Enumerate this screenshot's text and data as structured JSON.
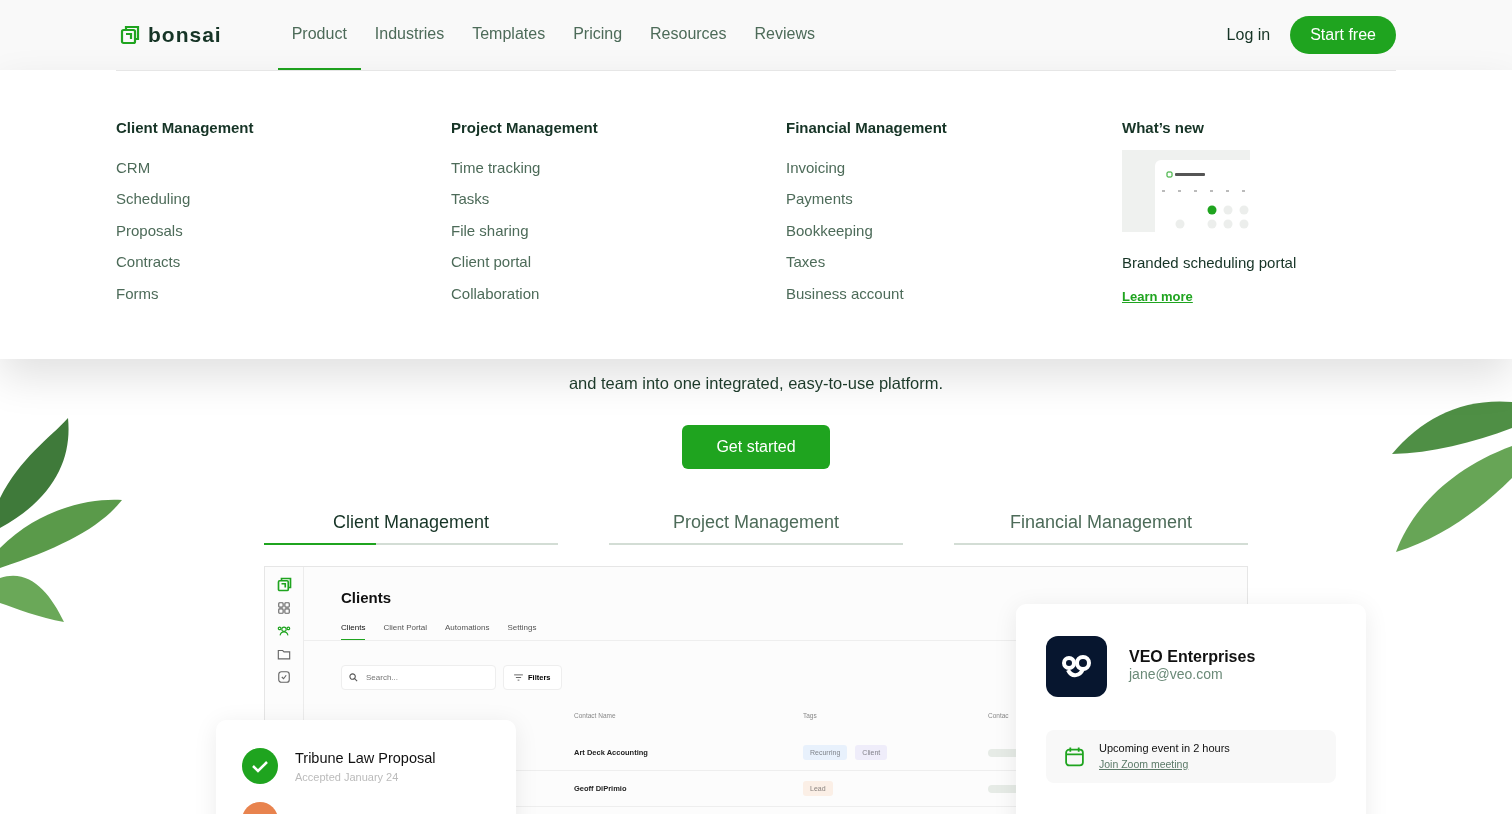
{
  "header": {
    "logo": "bonsai",
    "nav": [
      {
        "label": "Product",
        "selected": true
      },
      {
        "label": "Industries",
        "selected": false
      },
      {
        "label": "Templates",
        "selected": false
      },
      {
        "label": "Pricing",
        "selected": false
      },
      {
        "label": "Resources",
        "selected": false
      },
      {
        "label": "Reviews",
        "selected": false
      }
    ],
    "login": "Log in",
    "cta": "Start free"
  },
  "menu": {
    "columns": [
      {
        "title": "Client Management",
        "items": [
          "CRM",
          "Scheduling",
          "Proposals",
          "Contracts",
          "Forms"
        ]
      },
      {
        "title": "Project Management",
        "items": [
          "Time tracking",
          "Tasks",
          "File sharing",
          "Client portal",
          "Collaboration"
        ]
      },
      {
        "title": "Financial Management",
        "items": [
          "Invoicing",
          "Payments",
          "Bookkeeping",
          "Taxes",
          "Business account"
        ]
      }
    ],
    "whats_new": {
      "title": "What’s new",
      "caption": "Branded scheduling portal",
      "link": "Learn more"
    }
  },
  "hero": {
    "lines": [
      "and team into one integrated, easy-to-use platform."
    ],
    "button": "Get started"
  },
  "tabs": [
    {
      "label": "Client Management",
      "selected": true,
      "level": 0.38
    },
    {
      "label": "Project Management",
      "selected": false
    },
    {
      "label": "Financial Management",
      "selected": false
    }
  ],
  "app": {
    "sidebar": [
      {
        "kind": "grid",
        "selected": false
      },
      {
        "kind": "people",
        "selected": true
      },
      {
        "kind": "folder",
        "selected": false
      },
      {
        "kind": "task",
        "selected": false
      }
    ],
    "title": "Clients",
    "tabs": [
      {
        "label": "Clients",
        "selected": true
      },
      {
        "label": "Client Portal",
        "selected": false
      },
      {
        "label": "Automations",
        "selected": false
      },
      {
        "label": "Settings",
        "selected": false
      }
    ],
    "search": {
      "placeholder": "Search..."
    },
    "filters": "Filters",
    "columns": [
      "Contact Name",
      "Tags",
      "Contac"
    ],
    "rows": [
      {
        "name": "Art Deck Accounting",
        "tags": [
          {
            "label": "Recurring",
            "color": "#e8f1fc"
          },
          {
            "label": "Client",
            "color": "#efedfa"
          }
        ]
      },
      {
        "name": "Geoff DiPrimio",
        "tags": [
          {
            "label": "Lead",
            "color": "#fbefe6"
          }
        ]
      }
    ]
  },
  "proposals": [
    {
      "title": "Tribune Law Proposal",
      "subtitle": "Accepted January 24",
      "kind": "accepted"
    },
    {
      "kind": "pending"
    }
  ],
  "client_card": {
    "name": "VEO Enterprises",
    "email": "jane@veo.com",
    "event": {
      "title": "Upcoming event in 2 hours",
      "link": "Join Zoom meeting"
    }
  }
}
